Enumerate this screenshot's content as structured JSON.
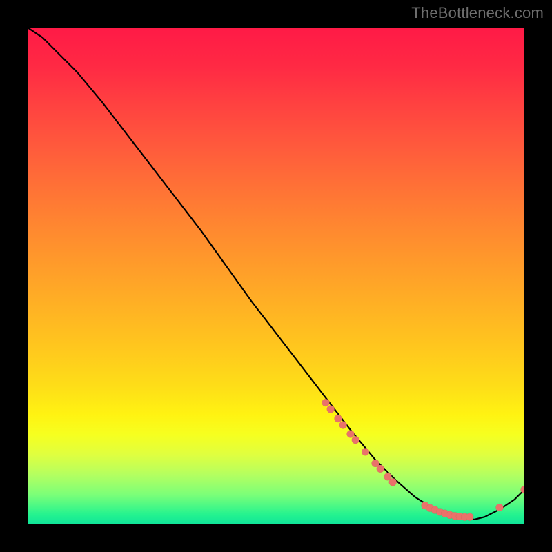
{
  "watermark": "TheBottleneck.com",
  "colors": {
    "background": "#000000",
    "curve": "#000000",
    "marker": "#e9726a",
    "watermark": "#6e6e6e"
  },
  "chart_data": {
    "type": "line",
    "title": "",
    "xlabel": "",
    "ylabel": "",
    "xlim": [
      0,
      100
    ],
    "ylim": [
      0,
      100
    ],
    "grid": false,
    "legend": false,
    "series": [
      {
        "name": "curve",
        "x": [
          0,
          3,
          6,
          10,
          15,
          20,
          25,
          30,
          35,
          40,
          45,
          50,
          55,
          60,
          65,
          70,
          74,
          78,
          82,
          86,
          88,
          90,
          92,
          95,
          98,
          100
        ],
        "y": [
          100,
          98,
          95,
          91,
          85,
          78.5,
          72,
          65.5,
          59,
          52,
          45,
          38.5,
          32,
          25.5,
          19,
          13,
          9,
          5.5,
          3,
          1.5,
          1,
          1,
          1.5,
          3,
          5,
          7
        ]
      }
    ],
    "markers": [
      {
        "x": 60,
        "y": 24.5
      },
      {
        "x": 61,
        "y": 23.2
      },
      {
        "x": 62.5,
        "y": 21.3
      },
      {
        "x": 63.5,
        "y": 20.0
      },
      {
        "x": 65,
        "y": 18.2
      },
      {
        "x": 66,
        "y": 17.0
      },
      {
        "x": 68,
        "y": 14.6
      },
      {
        "x": 70,
        "y": 12.3
      },
      {
        "x": 71,
        "y": 11.2
      },
      {
        "x": 72.5,
        "y": 9.6
      },
      {
        "x": 73.5,
        "y": 8.5
      },
      {
        "x": 80,
        "y": 3.8
      },
      {
        "x": 81,
        "y": 3.3
      },
      {
        "x": 82,
        "y": 2.9
      },
      {
        "x": 83,
        "y": 2.5
      },
      {
        "x": 84,
        "y": 2.2
      },
      {
        "x": 85,
        "y": 1.9
      },
      {
        "x": 86,
        "y": 1.7
      },
      {
        "x": 87,
        "y": 1.6
      },
      {
        "x": 88,
        "y": 1.5
      },
      {
        "x": 89,
        "y": 1.5
      },
      {
        "x": 95,
        "y": 3.4
      },
      {
        "x": 100,
        "y": 7.0
      }
    ],
    "marker_radius": 5.5
  }
}
